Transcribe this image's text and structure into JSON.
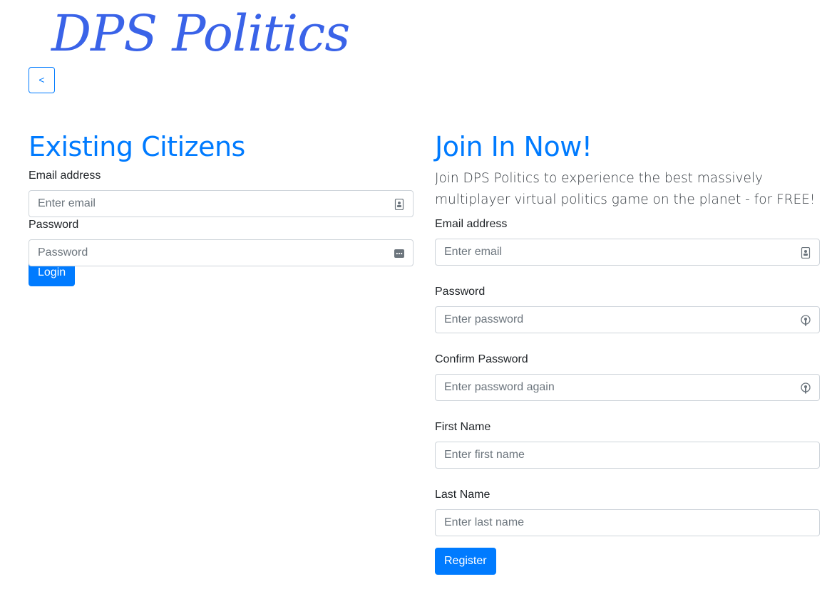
{
  "brand": {
    "title": "DPS Politics"
  },
  "nav": {
    "back_label": "<"
  },
  "login": {
    "heading": "Existing Citizens",
    "email_label": "Email address",
    "email_placeholder": "Enter email",
    "password_label": "Password",
    "password_placeholder": "Password",
    "submit_label": "Login"
  },
  "register": {
    "heading": "Join In Now!",
    "lead": "Join DPS Politics to experience the best massively multiplayer virtual politics game on the planet - for FREE!",
    "email_label": "Email address",
    "email_placeholder": "Enter email",
    "password_label": "Password",
    "password_placeholder": "Enter password",
    "confirm_label": "Confirm Password",
    "confirm_placeholder": "Enter password again",
    "first_name_label": "First Name",
    "first_name_placeholder": "Enter first name",
    "last_name_label": "Last Name",
    "last_name_placeholder": "Enter last name",
    "submit_label": "Register"
  },
  "icons": {
    "contact": "contact-card-icon",
    "password_dots": "password-dots-icon",
    "key": "key-icon"
  },
  "colors": {
    "accent": "#007bff",
    "brand": "#3a63e8",
    "input_border": "#ced4da"
  }
}
